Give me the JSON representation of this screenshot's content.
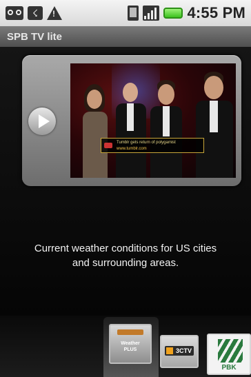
{
  "status_bar": {
    "time": "4:55 PM",
    "left_icons": [
      "voicemail-icon",
      "usb-icon",
      "warning-icon"
    ],
    "right_icons": [
      "vibrate-icon",
      "signal-icon",
      "battery-icon"
    ]
  },
  "app": {
    "title": "SPB TV lite"
  },
  "preview": {
    "play_icon": "play-icon",
    "ticker_line1": "Tumblr gets return of polygamist",
    "ticker_line2": "www.tumblr.com"
  },
  "description": {
    "line1": "Current weather conditions for US cities",
    "line2": "and surrounding areas."
  },
  "channels": [
    {
      "name": "WeatherPlus",
      "label_line1": "Weather",
      "label_line2": "PLUS",
      "selected": true
    },
    {
      "name": "3CTV",
      "label": "3CTV",
      "selected": false
    },
    {
      "name": "PBK",
      "label": "PBK",
      "selected": false
    }
  ],
  "colors": {
    "title_bar": "#5f5f5f",
    "background": "#000000",
    "battery": "#3cc21f",
    "pbk_green": "#2a7a3e"
  }
}
